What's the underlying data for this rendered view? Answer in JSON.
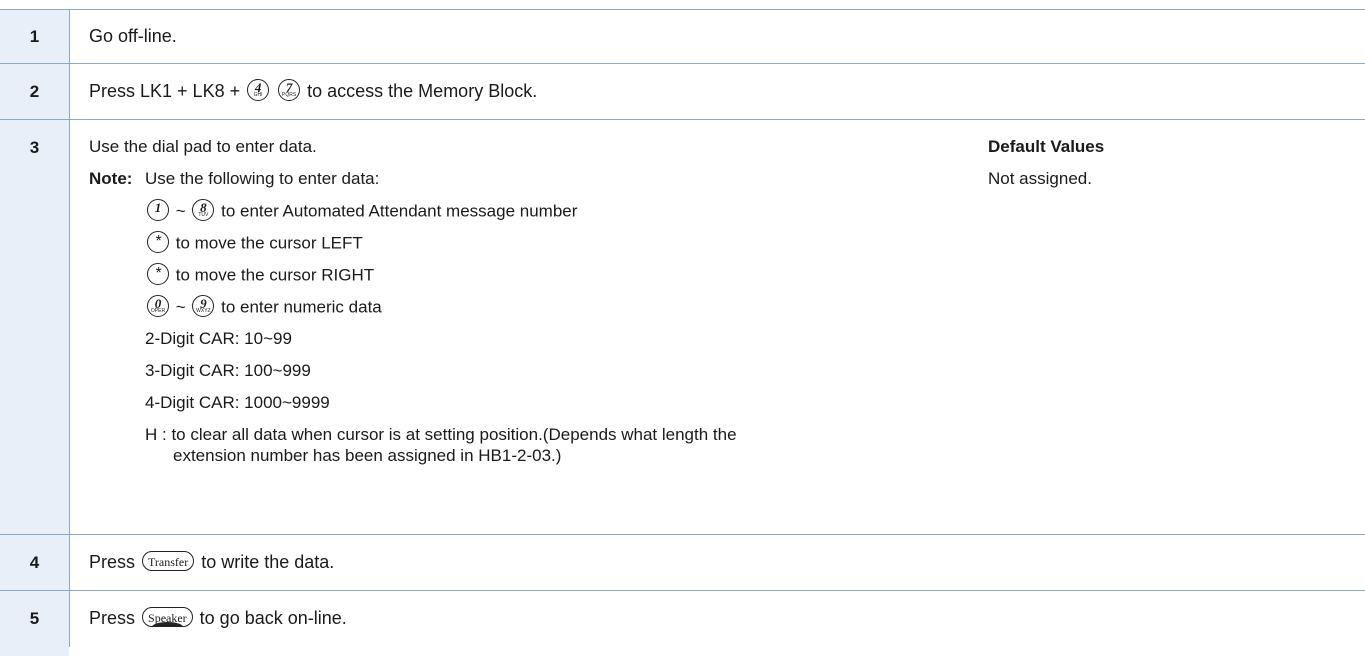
{
  "steps": [
    {
      "number": "1",
      "text": "Go off-line."
    },
    {
      "number": "2",
      "prefix": "Press LK1 + LK8 + ",
      "key_a": {
        "digit": "4",
        "letters": "GHI"
      },
      "key_b": {
        "digit": "7",
        "letters": "PQRS"
      },
      "suffix": " to access the Memory Block."
    },
    {
      "number": "3",
      "intro": "Use the dial pad to enter data.",
      "note_label": "Note:",
      "note_text": "Use the following to enter data:",
      "line1": {
        "key_a": {
          "digit": "1",
          "letters": ""
        },
        "sep": " ~ ",
        "key_b": {
          "digit": "8",
          "letters": "TUV"
        },
        "text": "  to enter Automated Attendant message number"
      },
      "line2": {
        "key": "*",
        "text": " to move the cursor LEFT"
      },
      "line3": {
        "key": "*",
        "text": " to move the cursor RIGHT"
      },
      "line4": {
        "key_a": {
          "digit": "0",
          "letters": "OPER"
        },
        "sep": " ~ ",
        "key_b": {
          "digit": "9",
          "letters": "WXYZ"
        },
        "text": " to enter numeric data"
      },
      "car2": "2-Digit CAR: 10~99",
      "car3": "3-Digit CAR: 100~999",
      "car4": "4-Digit CAR: 1000~9999",
      "h_line1": "H  :  to clear all data when cursor is at setting position.(Depends what length the",
      "h_line2": "extension number has been assigned in HB1-2-03.)",
      "default_label": "Default Values",
      "default_value": "Not assigned."
    },
    {
      "number": "4",
      "prefix": "Press ",
      "key": "Transfer",
      "suffix": " to write the data."
    },
    {
      "number": "5",
      "prefix": "Press ",
      "key": "Speaker",
      "suffix": " to go back on-line."
    }
  ]
}
